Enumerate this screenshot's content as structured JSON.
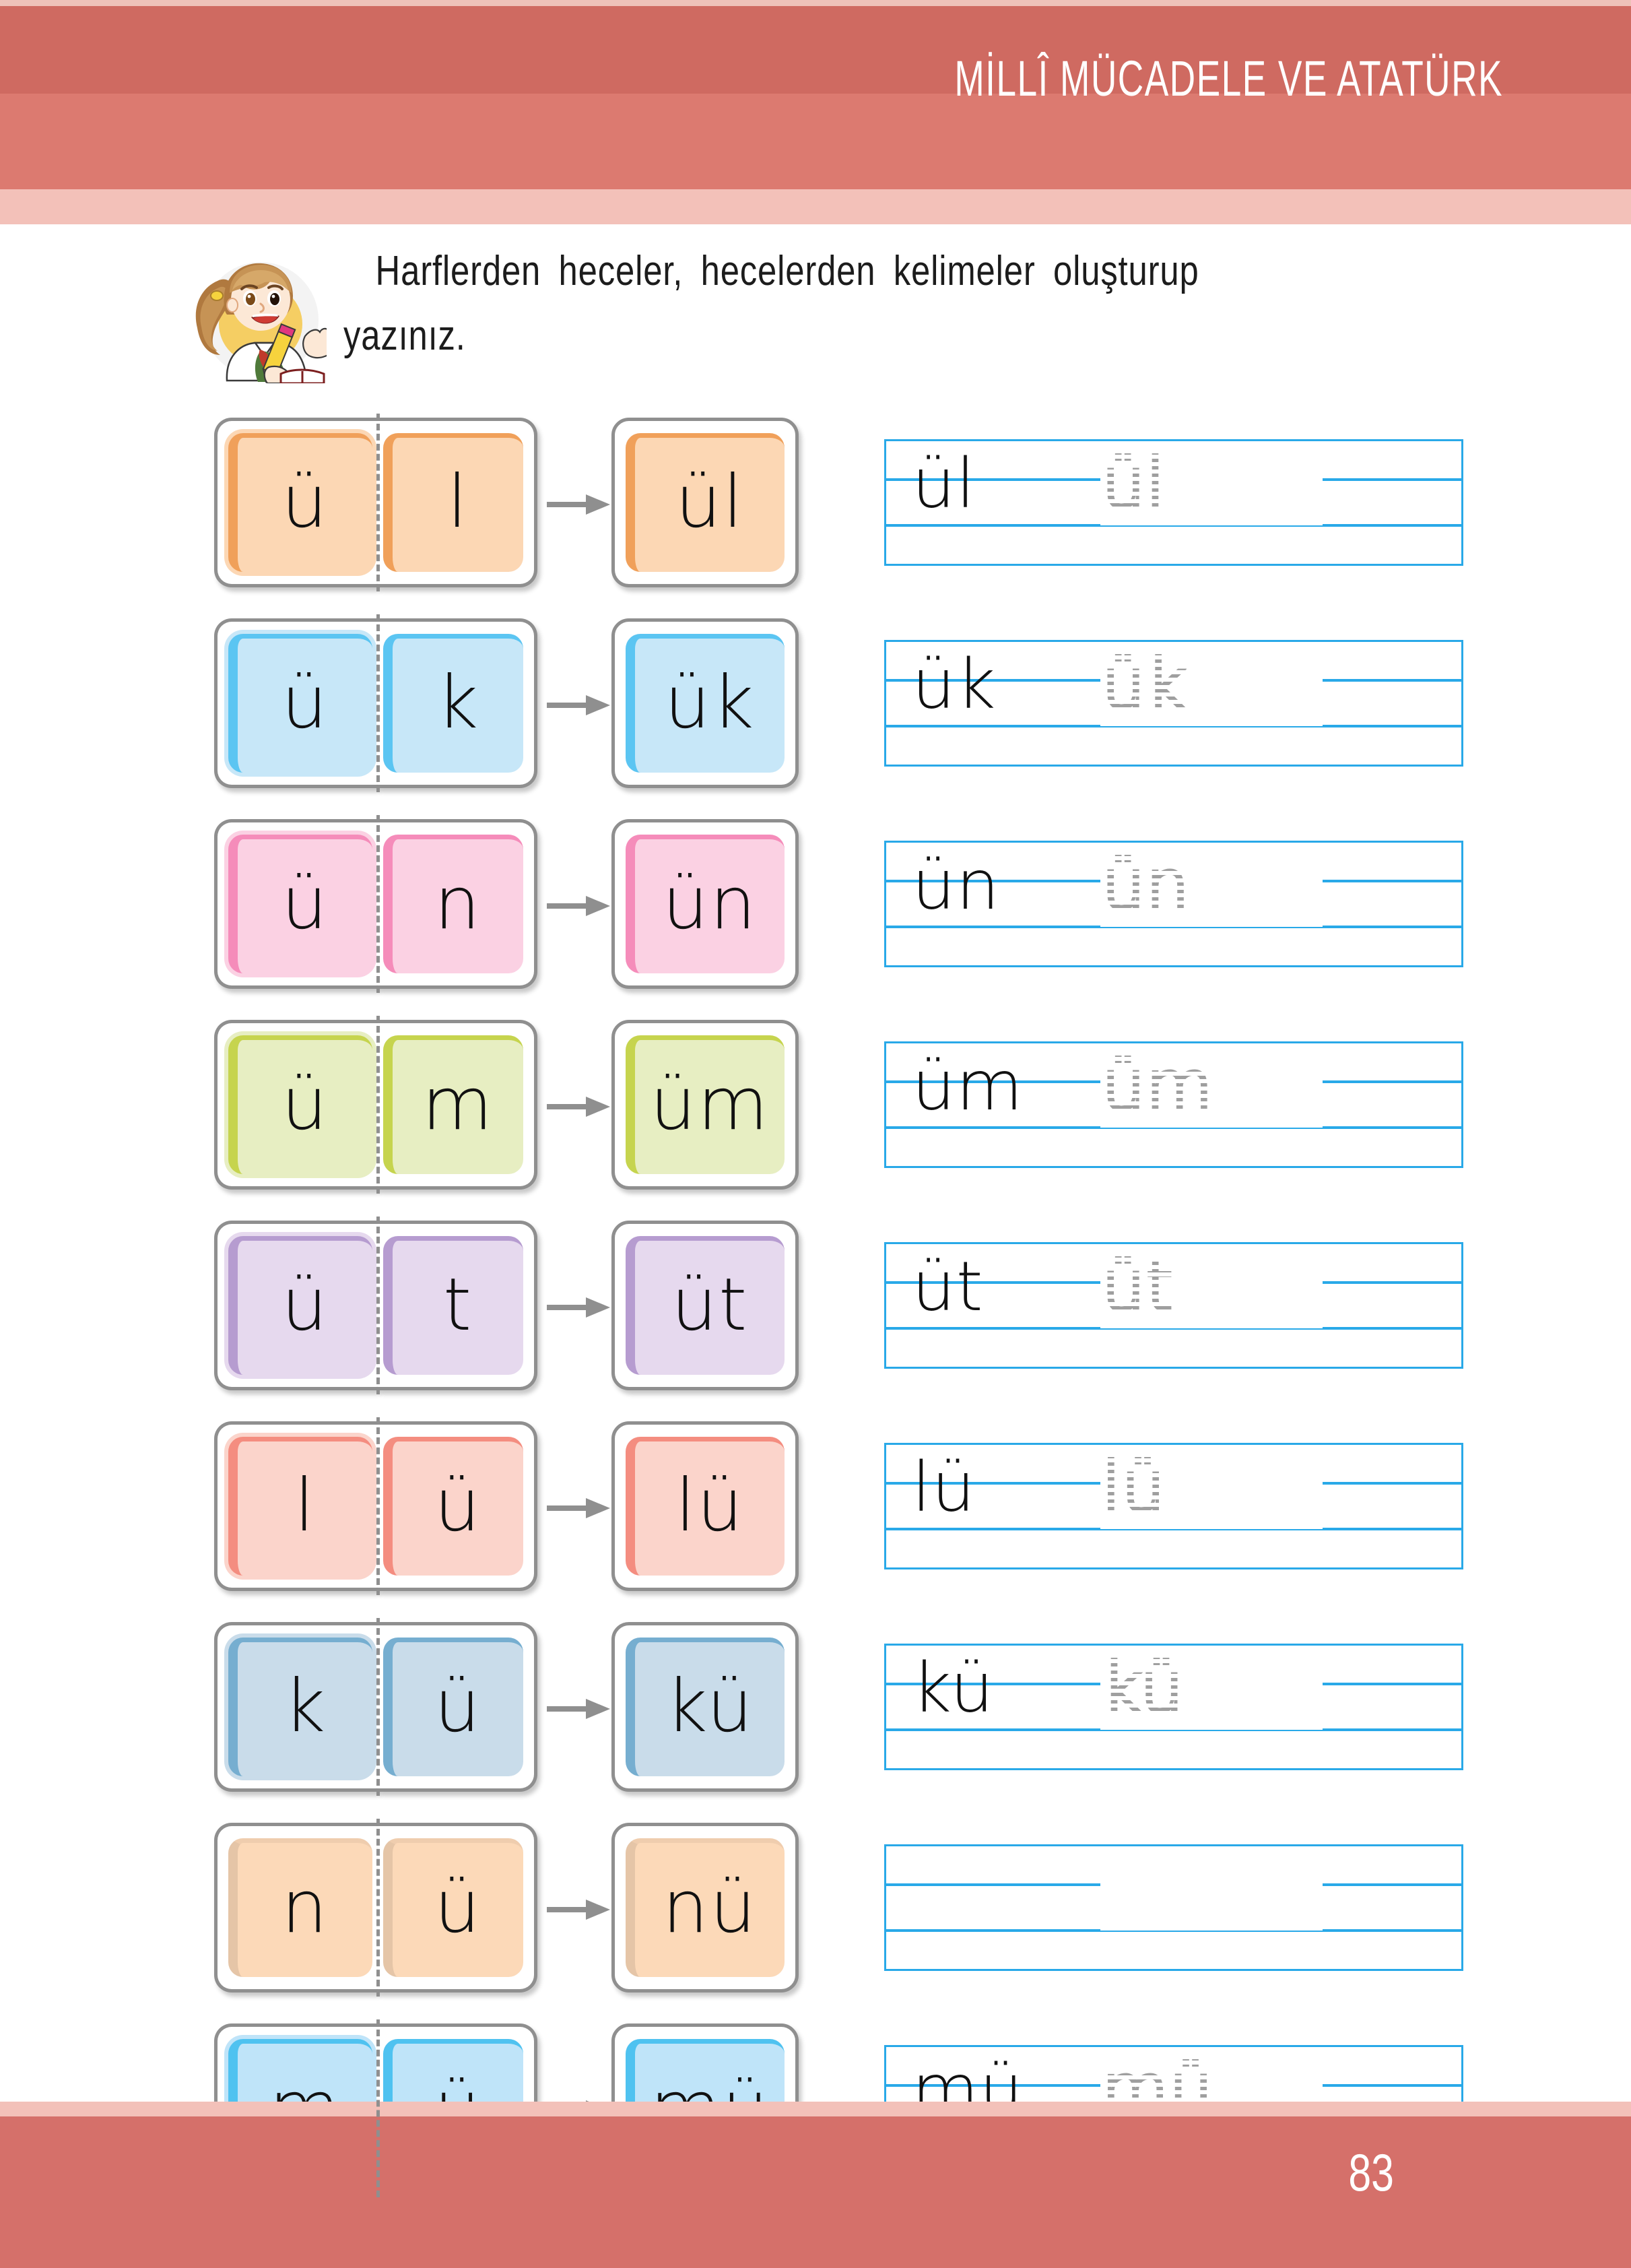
{
  "header": {
    "title": "MİLLÎ MÜCADELE VE ATATÜRK",
    "band_color": "#d5706a",
    "accent_color": "#f3c1b9"
  },
  "instruction": {
    "line1": "Harflerden heceler, hecelerden kelimeler oluşturup",
    "line2": "yazınız.",
    "mascot_icon": "girl-writing-icon"
  },
  "exercises": [
    {
      "letter1": "ü",
      "letter2": "l",
      "result": "ül",
      "fill": "#fcd7b4",
      "border": "#f0a05a",
      "write_text": "ül",
      "trace_text": "ül"
    },
    {
      "letter1": "ü",
      "letter2": "k",
      "result": "ük",
      "fill": "#c7e7f8",
      "border": "#5bc5f2",
      "write_text": "ük",
      "trace_text": "ük"
    },
    {
      "letter1": "ü",
      "letter2": "n",
      "result": "ün",
      "fill": "#fbd1e3",
      "border": "#f58cba",
      "write_text": "ün",
      "trace_text": "ün"
    },
    {
      "letter1": "ü",
      "letter2": "m",
      "result": "üm",
      "fill": "#e7eec2",
      "border": "#c6d44e",
      "write_text": "üm",
      "trace_text": "üm"
    },
    {
      "letter1": "ü",
      "letter2": "t",
      "result": "üt",
      "fill": "#e6d9ee",
      "border": "#b69cd0",
      "write_text": "üt",
      "trace_text": "üt"
    },
    {
      "letter1": "l",
      "letter2": "ü",
      "result": "lü",
      "fill": "#fbd4cb",
      "border": "#f48d80",
      "write_text": "lü",
      "trace_text": "lü"
    },
    {
      "letter1": "k",
      "letter2": "ü",
      "result": "kü",
      "fill": "#c9dcea",
      "border": "#76aed0",
      "write_text": "kü",
      "trace_text": "kü"
    },
    {
      "letter1": "n",
      "letter2": "ü",
      "result": "nü",
      "fill": "#fcd9b8",
      "border": "#f3a košice"
    },
    {
      "letter1": "m",
      "letter2": "ü",
      "result": "mü",
      "fill": "#bfe4f9",
      "border": "#4fc2f0",
      "write_text": "mü",
      "trace_text": "mü"
    }
  ],
  "footer": {
    "page_number": "83",
    "band_color": "#d5706a"
  },
  "icons": {
    "arrow": "arrow-right-icon"
  }
}
